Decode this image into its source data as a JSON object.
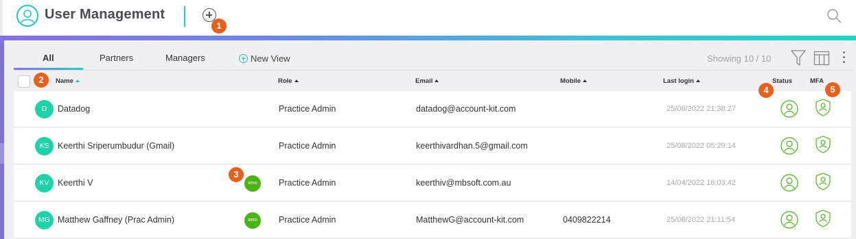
{
  "header": {
    "title": "User Management"
  },
  "tabs": [
    {
      "label": "All"
    },
    {
      "label": "Partners"
    },
    {
      "label": "Managers"
    }
  ],
  "new_view_label": "New View",
  "showing_text": "Showing 10 / 10",
  "columns": {
    "name": "Name",
    "role": "Role",
    "email": "Email",
    "mobile": "Mobile",
    "last_login": "Last login",
    "status": "Status",
    "mfa": "MFA"
  },
  "badges": [
    "1",
    "2",
    "3",
    "4",
    "5"
  ],
  "rows": [
    {
      "initials": "D",
      "name": "Datadog",
      "xero": "",
      "role": "Practice Admin",
      "email": "datadog@account-kit.com",
      "mobile": "",
      "last_login": "25/08/2022 21:38:27"
    },
    {
      "initials": "KS",
      "name": "Keerthi Sriperumbudur (Gmail)",
      "xero": "",
      "role": "Practice Admin",
      "email": "keerthivardhan.5@gmail.com",
      "mobile": "",
      "last_login": "25/08/2022 05:29:14"
    },
    {
      "initials": "KV",
      "name": "Keerthi V",
      "xero": "xero",
      "role": "Practice Admin",
      "email": "keerthiv@mbsoft.com.au",
      "mobile": "",
      "last_login": "14/04/2022 16:03:42"
    },
    {
      "initials": "MG",
      "name": "Matthew Gaffney (Prac Admin)",
      "xero": "xero",
      "role": "Practice Admin",
      "email": "MatthewG@account-kit.com",
      "mobile": "0409822214",
      "last_login": "25/08/2022 21:11:54"
    }
  ],
  "colors": {
    "accent": "#1fc8c0",
    "avatar": "#1fd3a8",
    "xero": "#4bb217",
    "badge": "#e8601c",
    "status_icon": "#4bb217"
  },
  "icons": [
    "user-circle-icon",
    "add-circle-icon",
    "search-icon",
    "plus-circle-icon",
    "filter-icon",
    "columns-icon",
    "more-vertical-icon",
    "user-status-icon",
    "shield-user-icon",
    "xero-logo"
  ]
}
